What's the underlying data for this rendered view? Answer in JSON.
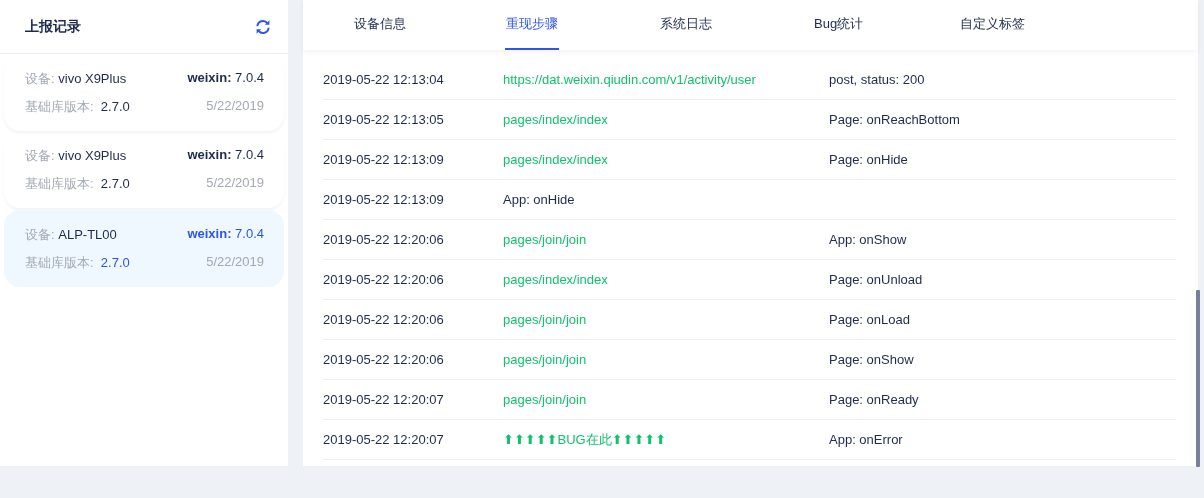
{
  "sidebar": {
    "title": "上报记录",
    "items": [
      {
        "device_label": "设备:",
        "device": "vivo X9Plus",
        "client_label": "weixin:",
        "client_version": "7.0.4",
        "lib_label": "基础库版本:",
        "lib_version": "2.7.0",
        "date": "5/22/2019",
        "selected": false
      },
      {
        "device_label": "设备:",
        "device": "vivo X9Plus",
        "client_label": "weixin:",
        "client_version": "7.0.4",
        "lib_label": "基础库版本:",
        "lib_version": "2.7.0",
        "date": "5/22/2019",
        "selected": false
      },
      {
        "device_label": "设备:",
        "device": "ALP-TL00",
        "client_label": "weixin:",
        "client_version": "7.0.4",
        "lib_label": "基础库版本:",
        "lib_version": "2.7.0",
        "date": "5/22/2019",
        "selected": true
      }
    ]
  },
  "tabs": [
    {
      "label": "设备信息",
      "selected": false
    },
    {
      "label": "重现步骤",
      "selected": true
    },
    {
      "label": "系统日志",
      "selected": false
    },
    {
      "label": "Bug统计",
      "selected": false
    },
    {
      "label": "自定义标签",
      "selected": false
    }
  ],
  "log": {
    "rows": [
      {
        "time": "2019-05-22 12:13:04",
        "kind": "link",
        "detail": "https://dat.weixin.qiudin.com/v1/activity/user",
        "event": "post, status: 200"
      },
      {
        "time": "2019-05-22 12:13:05",
        "kind": "link",
        "detail": "pages/index/index",
        "event": "Page: onReachBottom"
      },
      {
        "time": "2019-05-22 12:13:09",
        "kind": "link",
        "detail": "pages/index/index",
        "event": "Page: onHide"
      },
      {
        "time": "2019-05-22 12:13:09",
        "kind": "text",
        "detail": "App: onHide"
      },
      {
        "time": "2019-05-22 12:20:06",
        "kind": "link",
        "detail": "pages/join/join",
        "event": "App: onShow"
      },
      {
        "time": "2019-05-22 12:20:06",
        "kind": "link",
        "detail": "pages/index/index",
        "event": "Page: onUnload"
      },
      {
        "time": "2019-05-22 12:20:06",
        "kind": "link",
        "detail": "pages/join/join",
        "event": "Page: onLoad"
      },
      {
        "time": "2019-05-22 12:20:06",
        "kind": "link",
        "detail": "pages/join/join",
        "event": "Page: onShow"
      },
      {
        "time": "2019-05-22 12:20:07",
        "kind": "link",
        "detail": "pages/join/join",
        "event": "Page: onReady"
      },
      {
        "time": "2019-05-22 12:20:07",
        "kind": "marker",
        "detail": "⬆⬆⬆⬆⬆BUG在此⬆⬆⬆⬆⬆",
        "event": "App: onError"
      }
    ]
  }
}
